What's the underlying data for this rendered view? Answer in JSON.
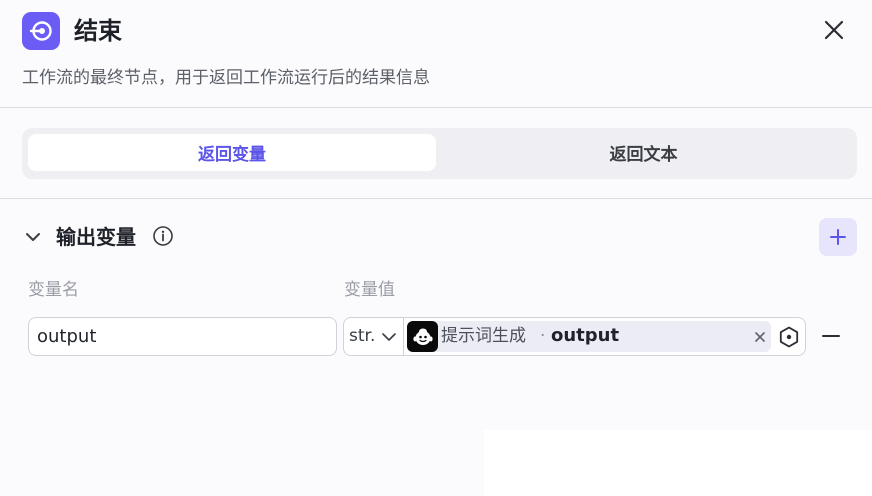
{
  "header": {
    "title": "结束",
    "description": "工作流的最终节点，用于返回工作流运行后的结果信息",
    "node_icon": "end-node-icon",
    "close_icon": "close-icon"
  },
  "tabs": [
    {
      "label": "返回变量",
      "active": true
    },
    {
      "label": "返回文本",
      "active": false
    }
  ],
  "output_section": {
    "title": "输出变量",
    "expanded": true,
    "columns": {
      "name": "变量名",
      "value": "变量值"
    },
    "rows": [
      {
        "name": "output",
        "type": "str.",
        "ref_source": "提示词生成",
        "ref_separator": "·",
        "ref_variable": "output"
      }
    ]
  },
  "colors": {
    "accent": "#5c56e8",
    "node_icon_bg": "#6a5cf4",
    "add_button_bg": "#e6e5fb",
    "chip_bg": "#ececf4"
  }
}
